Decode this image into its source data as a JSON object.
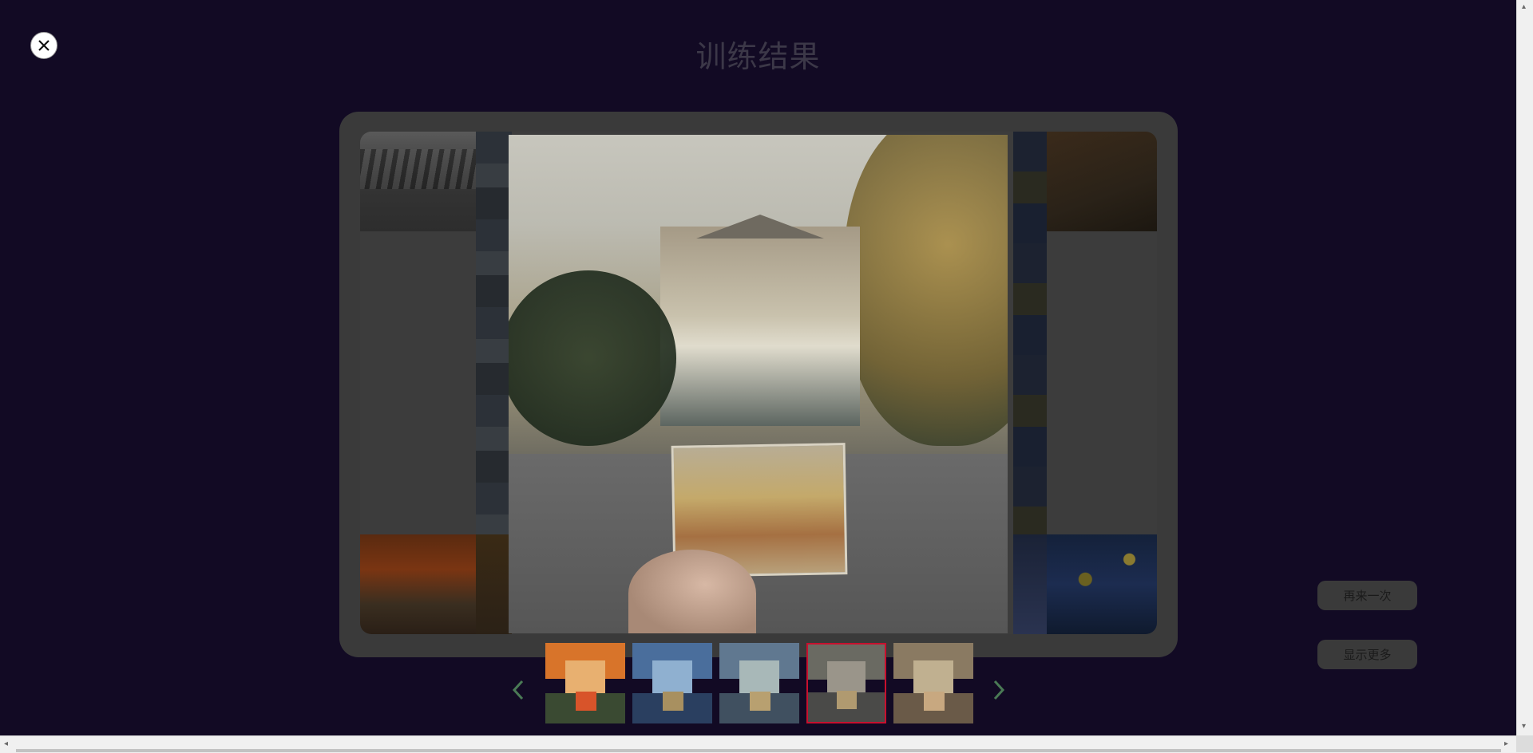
{
  "page": {
    "title": "训练结果",
    "background_color": "#120a24"
  },
  "close_button": {
    "icon": "close-icon"
  },
  "gallery": {
    "styles": [
      "ink-wash-landscape",
      "the-scream",
      "starry-night"
    ]
  },
  "viewer": {
    "prev_icon": "chevron-left-icon",
    "next_icon": "chevron-right-icon"
  },
  "thumbnails": {
    "items": [
      {
        "name": "orange-style"
      },
      {
        "name": "blue-style"
      },
      {
        "name": "teal-style"
      },
      {
        "name": "gray-style",
        "selected": true
      },
      {
        "name": "sepia-style"
      }
    ],
    "selected_color": "#c8102e"
  },
  "actions": {
    "retry_label": "再来一次",
    "more_label": "显示更多"
  },
  "scrollbars": {
    "left_arrow": "◂",
    "right_arrow": "▸",
    "up_arrow": "▴",
    "down_arrow": "▾"
  }
}
